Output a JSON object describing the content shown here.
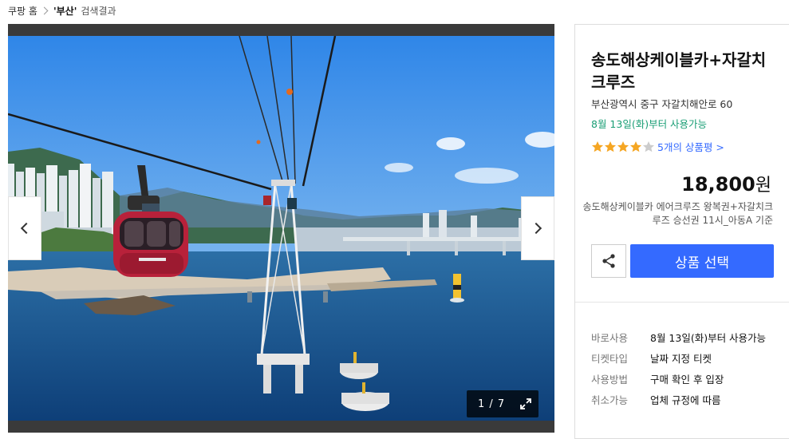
{
  "breadcrumb": {
    "home": "쿠팡 홈",
    "keyword": "'부산'",
    "suffix": "검색결과"
  },
  "gallery": {
    "counter": "1 / 7",
    "icons": {
      "prev": "chevron-left-icon",
      "next": "chevron-right-icon",
      "expand": "expand-icon"
    }
  },
  "product": {
    "title": "송도해상케이블카+자갈치크루즈",
    "address": "부산광역시 중구 자갈치해안로 60",
    "availability": "8월 13일(화)부터 사용가능",
    "rating": 4,
    "rating_max": 5,
    "review_link": "5개의 상품평 >",
    "price": "18,800",
    "price_unit": "원",
    "option_desc": "송도해상케이블카 에어크루즈 왕복권+자갈치크루즈 승선권 11시_아동A 기준",
    "select_button": "상품 선택",
    "share_icon": "share-icon"
  },
  "info": [
    {
      "label": "바로사용",
      "value": "8월 13일(화)부터 사용가능"
    },
    {
      "label": "티켓타입",
      "value": "날짜 지정 티켓"
    },
    {
      "label": "사용방법",
      "value": "구매 확인 후 입장"
    },
    {
      "label": "취소가능",
      "value": "업체 규정에 따름"
    }
  ],
  "colors": {
    "accent_blue": "#346aff",
    "availability_green": "#1a9e75",
    "star": "#f5a623",
    "star_empty": "#ccc"
  }
}
